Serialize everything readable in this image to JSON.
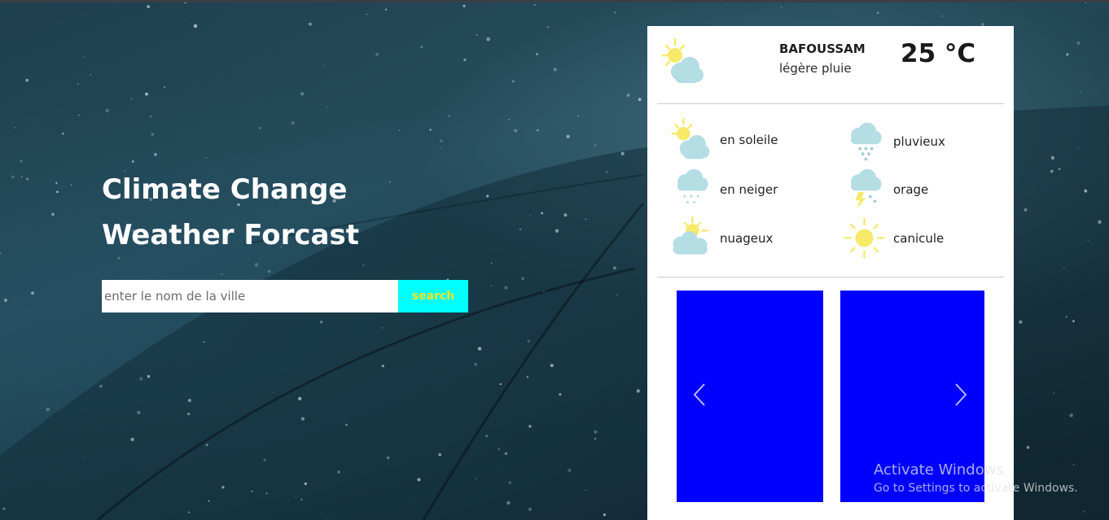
{
  "hero": {
    "title_line1": "Climate Change",
    "title_line2": "Weather Forcast"
  },
  "search": {
    "placeholder": "enter le nom de la ville",
    "button_label": "search"
  },
  "current": {
    "city": "BAFOUSSAM",
    "description": "légère pluie",
    "temperature": "25 °C",
    "icon": "sun-cloud-icon"
  },
  "legend": [
    {
      "label": "en soleile",
      "icon": "sun-cloud-icon"
    },
    {
      "label": "pluvieux",
      "icon": "rain-cloud-icon"
    },
    {
      "label": "en neiger",
      "icon": "snow-cloud-icon"
    },
    {
      "label": "orage",
      "icon": "storm-cloud-icon"
    },
    {
      "label": "nuageux",
      "icon": "partly-cloudy-icon"
    },
    {
      "label": "canicule",
      "icon": "sun-icon"
    }
  ],
  "carousel": {
    "slide_color": "#0000ff",
    "prev_icon": "chevron-left-icon",
    "next_icon": "chevron-right-icon"
  },
  "watermark": {
    "title": "Activate Windows",
    "subtitle": "Go to Settings to activate Windows."
  },
  "colors": {
    "search_button_bg": "#00ffff",
    "search_button_text": "#f4e422",
    "sun": "#f7e96a",
    "cloud": "#b4dde4"
  }
}
